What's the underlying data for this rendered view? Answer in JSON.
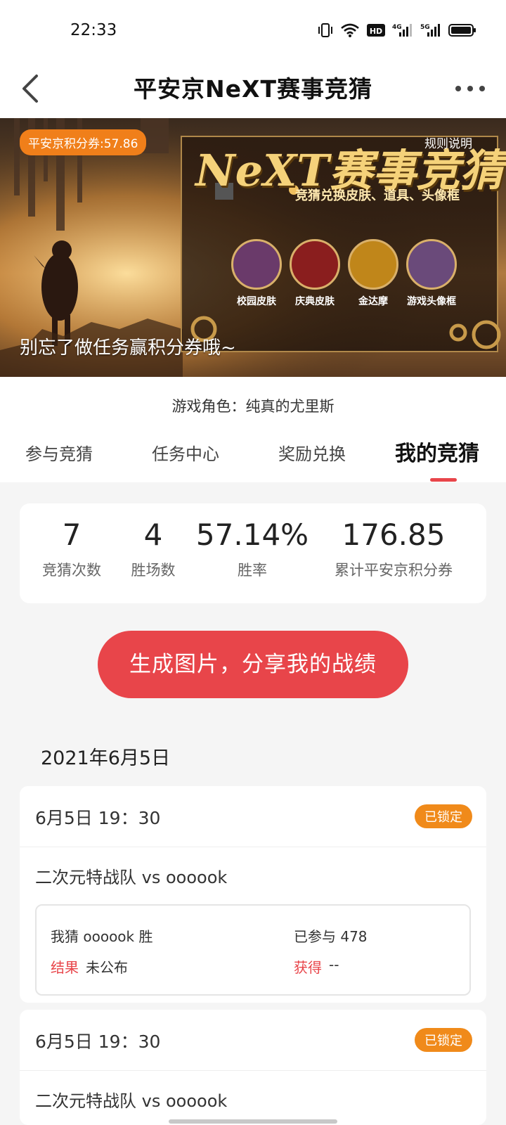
{
  "status_bar": {
    "time": "22:33",
    "icons": [
      "vibrate-icon",
      "wifi-icon",
      "hd-icon",
      "4g-signal-icon",
      "5g-signal-icon",
      "battery-icon"
    ]
  },
  "header": {
    "title": "平安京NeXT赛事竞猜"
  },
  "banner": {
    "points_badge": "平安京积分券:57.86",
    "rules_link": "规则说明",
    "title": "NeXT赛事竞猜",
    "subtitle": "竞猜兑换皮肤、道具、头像框",
    "rewards": [
      {
        "label": "校园皮肤"
      },
      {
        "label": "庆典皮肤"
      },
      {
        "label": "金达摩"
      },
      {
        "label": "游戏头像框"
      }
    ],
    "footer_text": "别忘了做任务赢积分券哦~"
  },
  "role": {
    "text": "游戏角色：纯真的尤里斯"
  },
  "tabs": [
    {
      "label": "参与竞猜"
    },
    {
      "label": "任务中心"
    },
    {
      "label": "奖励兑换"
    },
    {
      "label": "我的竞猜",
      "active": true
    }
  ],
  "stats": [
    {
      "value": "7",
      "label": "竞猜次数"
    },
    {
      "value": "4",
      "label": "胜场数"
    },
    {
      "value": "57.14%",
      "label": "胜率"
    },
    {
      "value": "176.85",
      "label": "累计平安京积分券"
    }
  ],
  "share_button": "生成图片，分享我的战绩",
  "date_heading": "2021年6月5日",
  "matches": [
    {
      "time": "6月5日 19：30",
      "status": "已锁定",
      "teams": "二次元特战队 vs oooook",
      "guess": "我猜 oooook 胜",
      "participants": "已参与 478",
      "result_label": "结果",
      "result_value": "未公布",
      "earn_label": "获得",
      "earn_value": "--"
    },
    {
      "time": "6月5日 19：30",
      "status": "已锁定",
      "teams": "二次元特战队 vs oooook"
    }
  ],
  "colors": {
    "accent_red": "#e8454a",
    "badge_orange": "#f08a1a"
  }
}
